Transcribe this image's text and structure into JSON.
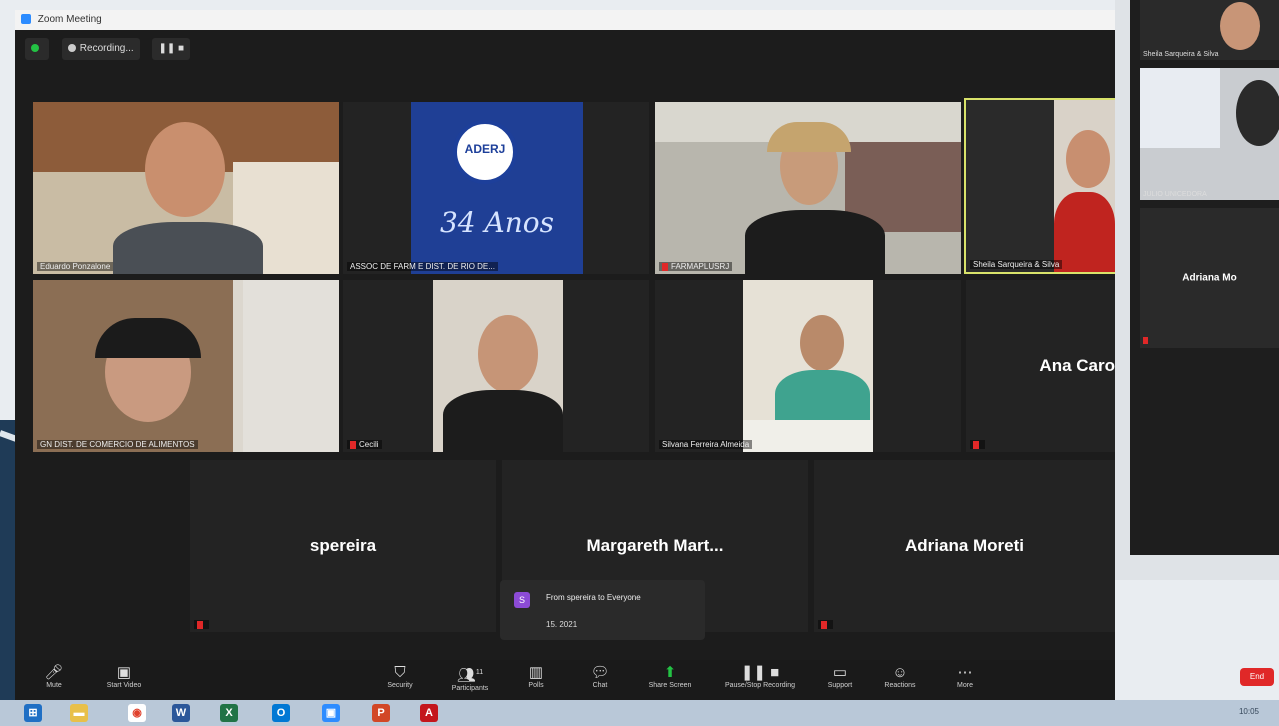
{
  "window": {
    "title": "Zoom Meeting"
  },
  "topbar": {
    "recording_label": "Recording..."
  },
  "tiles": {
    "t1": {
      "name": "Eduardo Ponzalone"
    },
    "t2": {
      "name": "ASSOC DE FARM E DIST. DE RIO DE...",
      "logo_text": "ADERJ",
      "anos_text": "34 Anos"
    },
    "t3": {
      "name": "FARMAPLUSRJ"
    },
    "t4": {
      "name": "Sheila Sarqueira & Silva"
    },
    "t5": {
      "name": "GN DIST. DE COMERCIO DE ALIMENTOS"
    },
    "t6": {
      "name": "Cecili"
    },
    "t7": {
      "name": "Silvana Ferreira Almeida"
    },
    "t8": {
      "name": "Ana Caro"
    },
    "t9": {
      "name": "spereira"
    },
    "t10": {
      "name": "Margareth  Mart..."
    },
    "t11": {
      "name": "Adriana Moreti"
    }
  },
  "chat_popup": {
    "badge": "S",
    "from": "From spereira to Everyone",
    "message": "15. 2021"
  },
  "toolbar": {
    "mute": "Mute",
    "video": "Start Video",
    "security": "Security",
    "participants": "Participants",
    "participants_count": "11",
    "polls": "Polls",
    "chat": "Chat",
    "share": "Share Screen",
    "record": "Pause/Stop Recording",
    "support": "Support",
    "reactions": "Reactions",
    "more": "More",
    "end": "End"
  },
  "side": {
    "s1": {
      "name": "Sheila Sarqueira & Silva"
    },
    "s2": {
      "name": "JULIO UNICEDORA"
    },
    "s3": {
      "name": "Adriana Mo"
    }
  },
  "taskbar": {
    "apps": [
      "W",
      "e",
      "X",
      "O",
      "P",
      "A"
    ],
    "tray_time": "10:05"
  },
  "colors": {
    "zoom_green": "#23c244",
    "mic_red": "#e02828",
    "active_speaker": "#d8e26a"
  }
}
